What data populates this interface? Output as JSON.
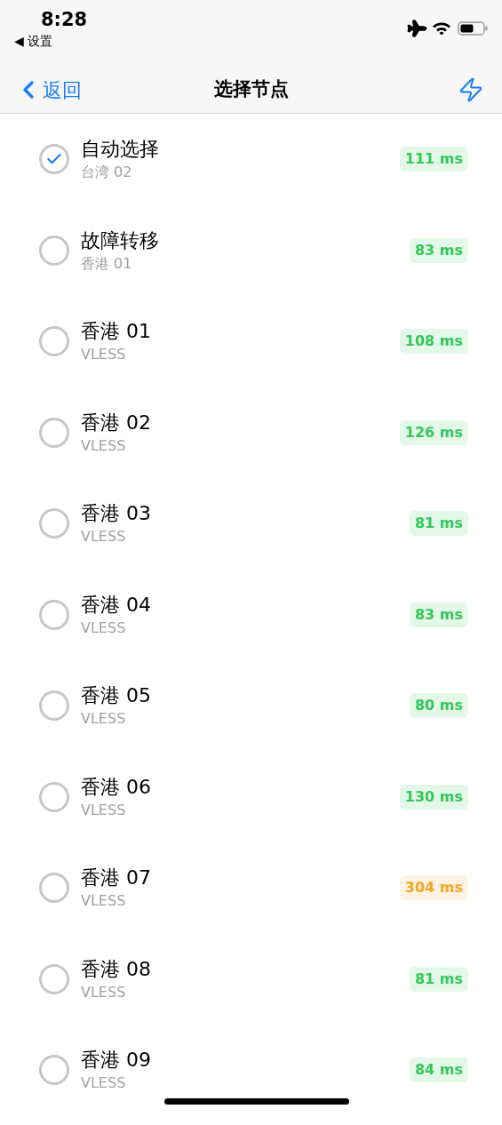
{
  "status_bar": {
    "time": "8:28",
    "back_app": "◀ 设置"
  },
  "nav_bar": {
    "back": "返回",
    "title": "选择节点"
  },
  "nodes": [
    {
      "name": "自动选择",
      "subtitle": "台湾 02",
      "latency": "111 ms",
      "color": "#34c759",
      "selected": true
    },
    {
      "name": "故障转移",
      "subtitle": "香港 01",
      "latency": "83 ms",
      "color": "#34c759",
      "selected": false
    },
    {
      "name": "香港 01",
      "subtitle": "VLESS",
      "latency": "108 ms",
      "color": "#34c759",
      "selected": false
    },
    {
      "name": "香港 02",
      "subtitle": "VLESS",
      "latency": "126 ms",
      "color": "#34c759",
      "selected": false
    },
    {
      "name": "香港 03",
      "subtitle": "VLESS",
      "latency": "81 ms",
      "color": "#34c759",
      "selected": false
    },
    {
      "name": "香港 04",
      "subtitle": "VLESS",
      "latency": "83 ms",
      "color": "#34c759",
      "selected": false
    },
    {
      "name": "香港 05",
      "subtitle": "VLESS",
      "latency": "80 ms",
      "color": "#34c759",
      "selected": false
    },
    {
      "name": "香港 06",
      "subtitle": "VLESS",
      "latency": "130 ms",
      "color": "#34c759",
      "selected": false
    },
    {
      "name": "香港 07",
      "subtitle": "VLESS",
      "latency": "304 ms",
      "color": "#f5a623",
      "selected": false
    },
    {
      "name": "香港 08",
      "subtitle": "VLESS",
      "latency": "81 ms",
      "color": "#34c759",
      "selected": false
    },
    {
      "name": "香港 09",
      "subtitle": "VLESS",
      "latency": "84 ms",
      "color": "#34c759",
      "selected": false
    }
  ]
}
